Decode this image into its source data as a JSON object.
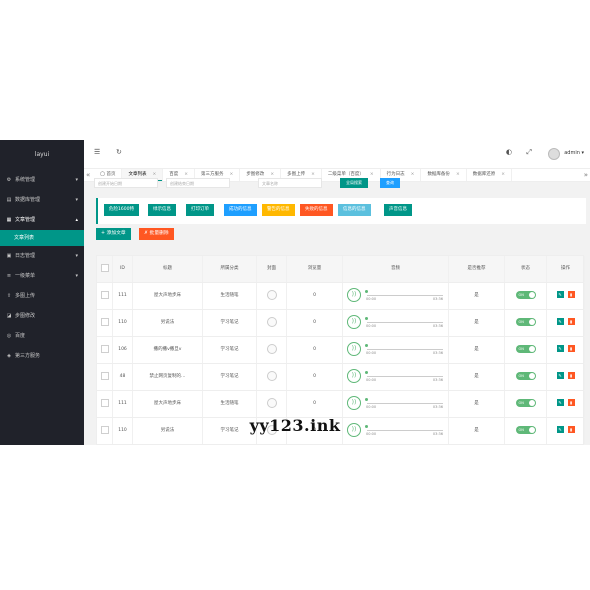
{
  "colors": {
    "sidebar": "#20222a",
    "accent": "#009688",
    "green": "#5fb878",
    "blue": "#1e9fff",
    "orange": "#ff5722",
    "gold": "#ffb800",
    "red": "#e74c3c"
  },
  "sidebar": {
    "logo": "layui",
    "items": [
      {
        "label": "系统管理",
        "icon": "gear-icon",
        "arrow": "▾"
      },
      {
        "label": "数据库管理",
        "icon": "database-icon",
        "arrow": "▾"
      },
      {
        "label": "文章管理",
        "icon": "article-icon",
        "arrow": "▴"
      },
      {
        "label": "日志管理",
        "icon": "log-icon",
        "arrow": "▾"
      },
      {
        "label": "一级菜单",
        "icon": "menu-icon",
        "arrow": "▾"
      },
      {
        "label": "多图上传",
        "icon": "upload-icon"
      },
      {
        "label": "步图修改",
        "icon": "image-icon"
      },
      {
        "label": "百度",
        "icon": "globe-icon"
      },
      {
        "label": "第三方服务",
        "icon": "service-icon"
      }
    ],
    "sub_item": "文章列表"
  },
  "header": {
    "user": "admin",
    "caret": "▾"
  },
  "tabs": {
    "items": [
      {
        "label": "首页",
        "home": true
      },
      {
        "label": "文章列表",
        "active": true
      },
      {
        "label": "百度"
      },
      {
        "label": "第三方服务"
      },
      {
        "label": "步图修改"
      },
      {
        "label": "多图上传"
      },
      {
        "label": "二级菜单（百度）"
      },
      {
        "label": "行为日志"
      },
      {
        "label": "数据库备份"
      },
      {
        "label": "数据库还原"
      }
    ],
    "close": "×",
    "left_arrow": "«",
    "right_arrow": "»"
  },
  "filters": {
    "start_placeholder": "创建开始日期",
    "end_placeholder": "创建结束日期",
    "title_placeholder": "文章名称",
    "fulltext_button": "全局搜索",
    "search_button": "查询"
  },
  "color_buttons": [
    {
      "label": "危险1600特",
      "color": "#009688"
    },
    {
      "label": "绿示信息",
      "color": "#009688"
    },
    {
      "label": "打印订单",
      "color": "#009688"
    },
    {
      "label": "成功的信息",
      "color": "#1e9fff"
    },
    {
      "label": "警告的信息",
      "color": "#ffb800"
    },
    {
      "label": "失败的信息",
      "color": "#ff5722"
    },
    {
      "label": "信息的信息",
      "color": "#5bc0de"
    },
    {
      "label": "声音信息",
      "color": "#009688"
    }
  ],
  "actions": {
    "add": "+ 添加文章",
    "batch_delete": "✗ 批量删除"
  },
  "table": {
    "columns": [
      "",
      "ID",
      "标题",
      "所属分类",
      "封面",
      "浏览量",
      "音频",
      "是否推荐",
      "状态",
      "操作"
    ],
    "rows": [
      {
        "id": "111",
        "title": "屋大声地步床",
        "category": "生活随笔",
        "views": "0",
        "t_start": "00:00",
        "t_end": "03:36",
        "recommend": "是",
        "status": "ON"
      },
      {
        "id": "110",
        "title": "另说法",
        "category": "学习笔记",
        "views": "0",
        "t_start": "00:00",
        "t_end": "03:36",
        "recommend": "是",
        "status": "ON"
      },
      {
        "id": "106",
        "title": "撒的撒v撒旦v",
        "category": "学习笔记",
        "views": "0",
        "t_start": "00:00",
        "t_end": "03:36",
        "recommend": "是",
        "status": "ON"
      },
      {
        "id": "48",
        "title": "禁止网页复制的…",
        "category": "学习笔记",
        "views": "0",
        "t_start": "00:00",
        "t_end": "03:36",
        "recommend": "是",
        "status": "ON"
      },
      {
        "id": "111",
        "title": "屋大声地步床",
        "category": "生活随笔",
        "views": "0",
        "t_start": "00:00",
        "t_end": "03:36",
        "recommend": "是",
        "status": "ON"
      },
      {
        "id": "110",
        "title": "另说法",
        "category": "学习笔记",
        "views": "0",
        "t_start": "00:00",
        "t_end": "03:36",
        "recommend": "是",
        "status": "ON"
      }
    ]
  },
  "watermark": "yy123.ink"
}
